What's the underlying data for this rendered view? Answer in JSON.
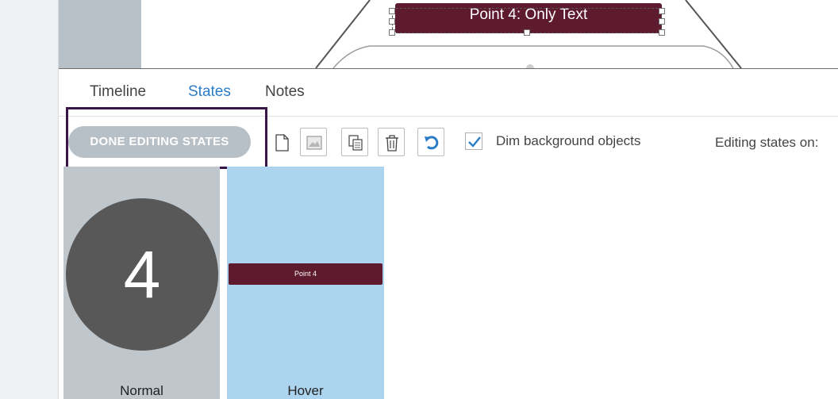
{
  "canvas": {
    "point_banner_text": "Point 4: Only Text"
  },
  "tabs": [
    {
      "label": "Timeline",
      "active": false
    },
    {
      "label": "States",
      "active": true
    },
    {
      "label": "Notes",
      "active": false
    }
  ],
  "toolbar": {
    "done_label": "DONE EDITING STATES",
    "tools": [
      "new-state-icon",
      "image-state-icon",
      "duplicate-state-icon",
      "delete-state-icon",
      "reset-state-icon"
    ],
    "dim_checked": true,
    "dim_label": "Dim background objects",
    "editing_label": "Editing states on:"
  },
  "states": [
    {
      "label": "Normal",
      "content": "4"
    },
    {
      "label": "Hover",
      "content": "Point 4"
    }
  ],
  "colors": {
    "accent": "#2b7cc7",
    "maroon": "#5e1a2f",
    "highlight_box": "#3a1547",
    "normal_bg": "#bfc6cc",
    "hover_bg": "#add4ef",
    "circle": "#585858"
  }
}
